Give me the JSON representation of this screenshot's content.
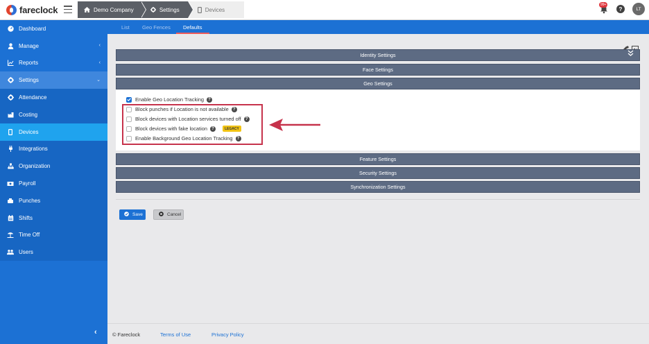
{
  "app": {
    "logo_text": "fareclock"
  },
  "breadcrumbs": [
    "Demo Company",
    "Settings",
    "Devices"
  ],
  "top": {
    "notification_count": "99+",
    "help": "?",
    "avatar_initials": "LT"
  },
  "sidebar": {
    "items": [
      {
        "label": "Dashboard",
        "icon": "dashboard-icon"
      },
      {
        "label": "Manage",
        "icon": "person-icon",
        "chevron": "‹"
      },
      {
        "label": "Reports",
        "icon": "chart-icon",
        "chevron": "‹"
      },
      {
        "label": "Settings",
        "icon": "gear-icon",
        "chevron": "⌄"
      },
      {
        "label": "Attendance",
        "icon": "gear-icon"
      },
      {
        "label": "Costing",
        "icon": "costing-icon"
      },
      {
        "label": "Devices",
        "icon": "device-icon"
      },
      {
        "label": "Integrations",
        "icon": "plug-icon"
      },
      {
        "label": "Organization",
        "icon": "org-icon"
      },
      {
        "label": "Payroll",
        "icon": "money-icon"
      },
      {
        "label": "Punches",
        "icon": "punch-icon"
      },
      {
        "label": "Shifts",
        "icon": "calendar-icon"
      },
      {
        "label": "Time Off",
        "icon": "beach-icon"
      },
      {
        "label": "Users",
        "icon": "users-icon"
      }
    ],
    "collapse": "‹"
  },
  "tabs": [
    "List",
    "Geo Fences",
    "Defaults"
  ],
  "sections": {
    "identity": "Identity Settings",
    "identity_chevron": "⌄⌄",
    "face": "Face Settings",
    "geo": "Geo Settings",
    "feature": "Feature Settings",
    "security": "Security Settings",
    "sync": "Synchronization Settings"
  },
  "geo_options": [
    {
      "label": "Enable Geo Location Tracking",
      "checked": true
    },
    {
      "label": "Block punches if Location is not available",
      "checked": false
    },
    {
      "label": "Block devices with Location services turned off",
      "checked": false
    },
    {
      "label": "Block devices with fake location",
      "checked": false,
      "badge": "LEGACY"
    },
    {
      "label": "Enable Background Geo Location Tracking",
      "checked": false
    }
  ],
  "buttons": {
    "save": "Save",
    "cancel": "Cancel"
  },
  "footer": {
    "copyright": "© Fareclock",
    "terms": "Terms of Use",
    "privacy": "Privacy Policy"
  },
  "colors": {
    "brand_blue": "#1c71d4",
    "active_item": "#1fa3ee",
    "section_bar": "#5d6b83",
    "highlight_red": "#c6324b",
    "legacy_yellow": "#f2c414"
  }
}
